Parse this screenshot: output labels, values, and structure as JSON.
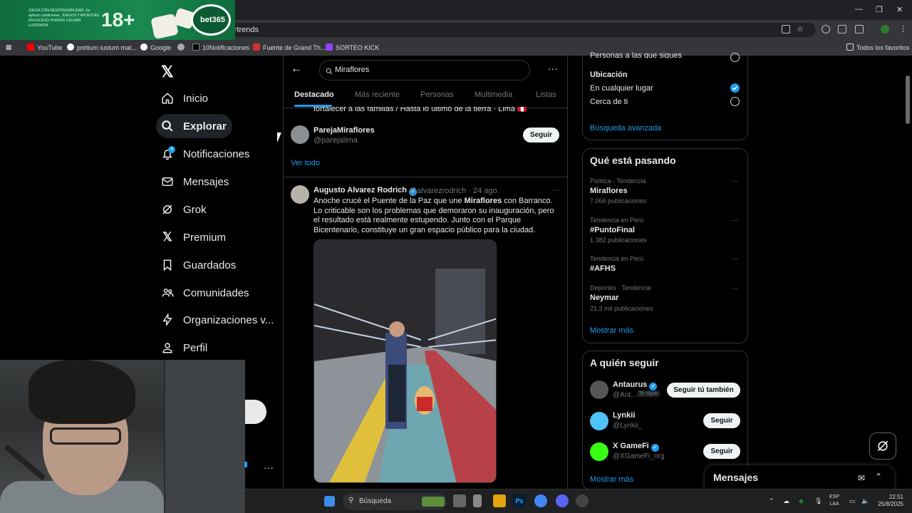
{
  "browser": {
    "address_fragment": "=trends",
    "bookmarks": [
      {
        "label": "YouTube",
        "color": "#ff0000"
      },
      {
        "label": "pretium iustum mat...",
        "color": "#ffffff"
      },
      {
        "label": "Google",
        "color": "#ffffff"
      },
      {
        "label": "",
        "color": "#aaaaaa"
      },
      {
        "label": "10Notificaciones",
        "color": "#000000"
      },
      {
        "label": "Fuente de Grand Th...",
        "color": "#d32f2f"
      },
      {
        "label": "SORTEO KICK",
        "color": "#9146ff"
      }
    ],
    "all_bookmarks": "Todos los favoritos"
  },
  "ad": {
    "small_text": "JUEGA CON RESPONSABILIDAD. Se aplican condiciones. JUEGOS Y APUESTAS EN EXCESO PUEDEN CAUSAR LUDOPATIA",
    "age": "18+",
    "brand": "bet365"
  },
  "nav": {
    "items": [
      {
        "label": "Inicio",
        "icon": "home-icon"
      },
      {
        "label": "Explorar",
        "icon": "search-icon"
      },
      {
        "label": "Notificaciones",
        "icon": "bell-icon"
      },
      {
        "label": "Mensajes",
        "icon": "mail-icon"
      },
      {
        "label": "Grok",
        "icon": "grok-icon"
      },
      {
        "label": "Premium",
        "icon": "x-icon"
      },
      {
        "label": "Guardados",
        "icon": "bookmark-icon"
      },
      {
        "label": "Comunidades",
        "icon": "people-icon"
      },
      {
        "label": "Organizaciones v...",
        "icon": "bolt-icon"
      },
      {
        "label": "Perfil",
        "icon": "person-icon"
      }
    ],
    "notif_badge": "8"
  },
  "search": {
    "value": "Miraflores",
    "tabs": [
      "Destacado",
      "Más reciente",
      "Personas",
      "Multimedia",
      "Listas"
    ]
  },
  "feed": {
    "cut_text": "fortalecer a las familias / Hasta lo último de la tierra · Lima 🇵🇪",
    "user": {
      "name": "ParejaMiraflores",
      "handle": "@parejalima",
      "follow": "Seguir"
    },
    "see_all": "Ver todo",
    "tweet": {
      "name": "Augusto Alvarez Rodrich",
      "meta": "@alvarezrodrich · 24 ago.",
      "text_before": "Anoche crucé el Puente de la Paz que une ",
      "bold": "Miraflores",
      "text_after": " con Barranco. Lo criticable son los problemas que demoraron su inauguración, pero el resultado está realmente estupendo. Junto con el Parque Bicentenario, constituye un gran espacio público para la ciudad."
    }
  },
  "filters": {
    "cut_label": "Personas a las que sigues",
    "location_title": "Ubicación",
    "opt_anywhere": "En cualquier lugar",
    "opt_near": "Cerca de ti",
    "advanced": "Búsqueda avanzada"
  },
  "trends": {
    "title": "Qué está pasando",
    "items": [
      {
        "context": "Política · Tendencia",
        "name": "Miraflores",
        "count": "7.066 publicaciones"
      },
      {
        "context": "Tendencia en Perú",
        "name": "#PuntoFinal",
        "count": "1.382 publicaciones"
      },
      {
        "context": "Tendencia en Perú",
        "name": "#AFHS",
        "count": ""
      },
      {
        "context": "Deportes · Tendencia",
        "name": "Neymar",
        "count": "21,3 mil publicaciones"
      }
    ],
    "more": "Mostrar más"
  },
  "who_to_follow": {
    "title": "A quién seguir",
    "items": [
      {
        "name": "Antaurus",
        "handle": "@Ant...",
        "badge": "Te sigue",
        "button": "Seguir tú también",
        "color": "#555555"
      },
      {
        "name": "Lynkii",
        "handle": "@Lynkii_",
        "badge": "",
        "button": "Seguir",
        "color": "#4fc3f7"
      },
      {
        "name": "X GameFi",
        "handle": "@XGameFi_org",
        "badge": "",
        "button": "Seguir",
        "color": "#39ff14"
      }
    ],
    "more": "Mostrar más"
  },
  "messages_drawer": {
    "title": "Mensajes"
  },
  "taskbar": {
    "search": "Búsqueda",
    "lang_top": "ESP",
    "lang_bottom": "LAA",
    "time": "22:51",
    "date": "25/8/2025"
  }
}
